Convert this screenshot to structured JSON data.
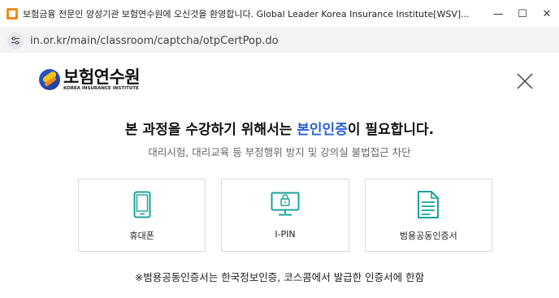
{
  "window": {
    "title": "보험금융 전문인 양성기관 보험연수원에 오신것을 환영합니다. Global Leader Korea Insurance Institute[WSV]...",
    "minimize": "—",
    "maximize": "☐",
    "close": "✕"
  },
  "address": {
    "url": "in.or.kr/main/classroom/captcha/otpCertPop.do"
  },
  "logo": {
    "name_ko": "보험연수원",
    "name_en": "KOREA INSURANCE INSTITUTE"
  },
  "headline": {
    "part1": "본 과정을 수강하기 위해서는 ",
    "highlight": "본인인증",
    "part2": "이 필요합니다."
  },
  "subline": "대리시험, 대리교육 등 부정행위 방지 및 강의실 불법접근 차단",
  "options": [
    {
      "label": "휴대폰",
      "icon": "mobile-phone-icon"
    },
    {
      "label": "I-PIN",
      "icon": "ipin-monitor-lock-icon"
    },
    {
      "label": "범용공동인증서",
      "icon": "certificate-document-icon"
    }
  ],
  "notice": "※범용공동인증서는 한국정보인증, 코스콤에서 발급한 인증서에 한함",
  "colors": {
    "accent": "#2a5fd1",
    "icon_teal": "#1aa39a"
  }
}
